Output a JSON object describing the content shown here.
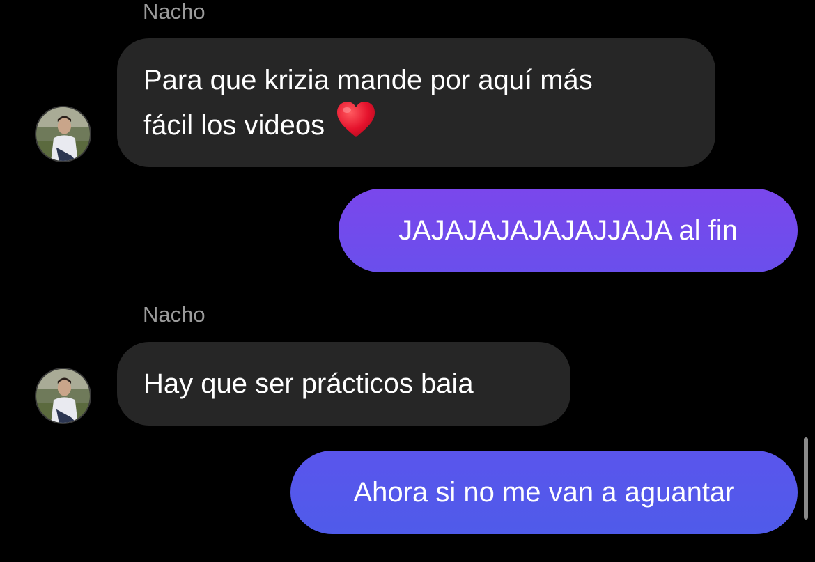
{
  "conversation": {
    "messages": [
      {
        "sender": "Nacho",
        "direction": "incoming",
        "lines": [
          "Para que krizia mande por aquí más",
          "fácil los videos"
        ],
        "emoji": "heart-icon"
      },
      {
        "direction": "outgoing",
        "text": "JAJAJAJAJAJAJJAJA al fin"
      },
      {
        "sender": "Nacho",
        "direction": "incoming",
        "text": "Hay que ser prácticos baia"
      },
      {
        "direction": "outgoing",
        "text": "Ahora si no me van a aguantar"
      }
    ]
  },
  "colors": {
    "background": "#000000",
    "incoming_bubble": "#262626",
    "outgoing_gradient_top": "#7a47ec",
    "outgoing_gradient_bottom": "#4f5bea",
    "sender_name": "#9b9b9b",
    "heart": "#e5122c"
  }
}
